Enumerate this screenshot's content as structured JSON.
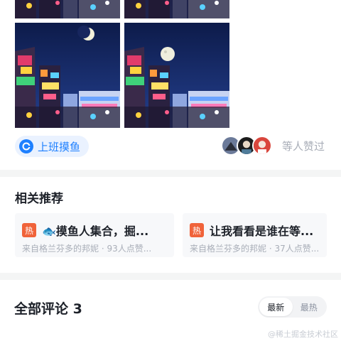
{
  "post": {
    "topic": {
      "label": "上班摸鱼",
      "icon": "topic-icon",
      "color": "#1e80ff"
    },
    "likes_text": "等人赞过",
    "images": [
      "night-street-photo",
      "night-street-photo",
      "night-street-crescent-moon-photo",
      "night-street-full-moon-photo"
    ]
  },
  "related": {
    "title": "相关推荐",
    "badge_label": "热",
    "badge_color": "#f0633a",
    "items": [
      {
        "title": "🐟摸鱼人集合，掘...",
        "meta": "来自格兰芬多的邦妮 · 93人点赞..."
      },
      {
        "title": "让我看看是谁在等...",
        "meta": "来自格兰芬多的邦妮 · 37人点赞..."
      }
    ]
  },
  "comments": {
    "title": "全部评论 3",
    "sort": {
      "newest": "最新",
      "hottest": "最热",
      "active": "newest"
    }
  },
  "watermark": "@稀土掘金技术社区"
}
